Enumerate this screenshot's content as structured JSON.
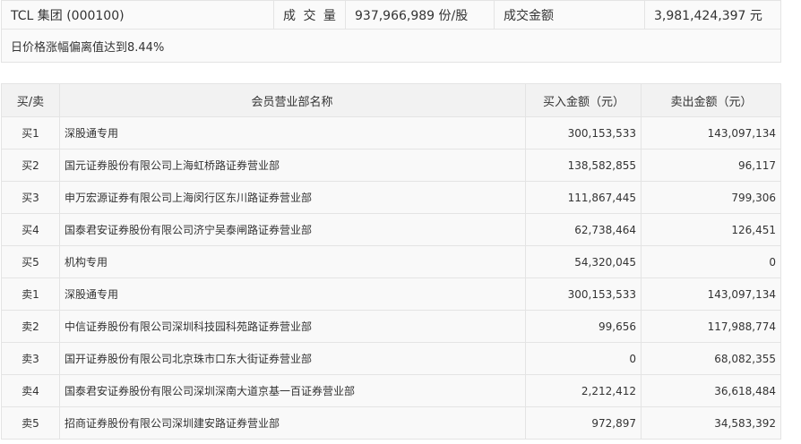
{
  "summary": {
    "stock": "TCL 集团 (000100)",
    "volume_label": "成 交 量",
    "volume_value": "937,966,989 份/股",
    "amount_label": "成交金额",
    "amount_value": "3,981,424,397 元",
    "reason": "日价格涨幅偏离值达到8.44%"
  },
  "table": {
    "headers": {
      "side": "买/卖",
      "name": "会员营业部名称",
      "buy": "买入金额（元）",
      "sell": "卖出金额（元）"
    },
    "rows": [
      {
        "side": "买1",
        "name": "深股通专用",
        "buy": "300,153,533",
        "sell": "143,097,134"
      },
      {
        "side": "买2",
        "name": "国元证券股份有限公司上海虹桥路证券营业部",
        "buy": "138,582,855",
        "sell": "96,117"
      },
      {
        "side": "买3",
        "name": "申万宏源证券有限公司上海闵行区东川路证券营业部",
        "buy": "111,867,445",
        "sell": "799,306"
      },
      {
        "side": "买4",
        "name": "国泰君安证券股份有限公司济宁吴泰闸路证券营业部",
        "buy": "62,738,464",
        "sell": "126,451"
      },
      {
        "side": "买5",
        "name": "机构专用",
        "buy": "54,320,045",
        "sell": "0"
      },
      {
        "side": "卖1",
        "name": "深股通专用",
        "buy": "300,153,533",
        "sell": "143,097,134"
      },
      {
        "side": "卖2",
        "name": "中信证券股份有限公司深圳科技园科苑路证券营业部",
        "buy": "99,656",
        "sell": "117,988,774"
      },
      {
        "side": "卖3",
        "name": "国开证券股份有限公司北京珠市口东大街证券营业部",
        "buy": "0",
        "sell": "68,082,355"
      },
      {
        "side": "卖4",
        "name": "国泰君安证券股份有限公司深圳深南大道京基一百证券营业部",
        "buy": "2,212,412",
        "sell": "36,618,484"
      },
      {
        "side": "卖5",
        "name": "招商证券股份有限公司深圳建安路证券营业部",
        "buy": "972,897",
        "sell": "34,583,392"
      }
    ]
  }
}
